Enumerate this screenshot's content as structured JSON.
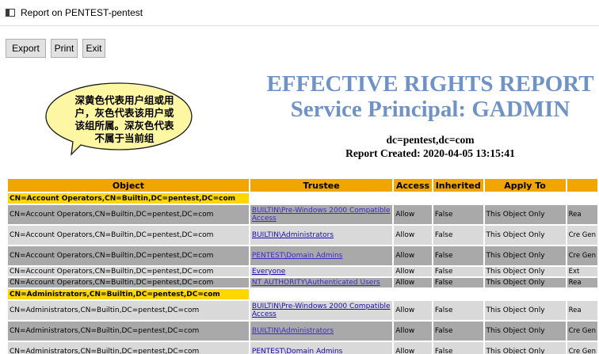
{
  "window": {
    "title": "Report on PENTEST-pentest"
  },
  "toolbar": {
    "export_label": "Export",
    "print_label": "Print",
    "exit_label": "Exit"
  },
  "callout": {
    "lines": [
      "深黄色代表用户组或用",
      "户，灰色代表该用户或",
      "该组所属。深灰色代表",
      "不属于当前组"
    ],
    "fill": "#fdf6a3",
    "stroke": "#1a1a1a"
  },
  "report": {
    "title": "EFFECTIVE RIGHTS REPORT",
    "subtitle": "Service Principal: GADMIN",
    "dc": "dc=pentest,dc=com",
    "created": "Report Created: 2020-04-05 13:15:41",
    "title_color": "#6f93c6"
  },
  "table": {
    "headers": [
      "Object",
      "Trustee",
      "Access",
      "Inherited",
      "Apply To",
      ""
    ],
    "header_color": "#f0a500",
    "group_color": "#ffd700",
    "rows": [
      {
        "kind": "group",
        "object": "CN=Account Operators,CN=Builtin,DC=pentest,DC=com"
      },
      {
        "kind": "dark tall",
        "object": "CN=Account Operators,CN=Builtin,DC=pentest,DC=com",
        "trustee": "BUILTIN\\Pre-Windows 2000 Compatible Access",
        "access": "Allow",
        "inherited": "False",
        "apply": "This Object Only",
        "perm": "Rea"
      },
      {
        "kind": "light tall",
        "object": "CN=Account Operators,CN=Builtin,DC=pentest,DC=com",
        "trustee": "BUILTIN\\Administrators",
        "access": "Allow",
        "inherited": "False",
        "apply": "This Object Only",
        "perm": "Cre Gen"
      },
      {
        "kind": "dark tall",
        "object": "CN=Account Operators,CN=Builtin,DC=pentest,DC=com",
        "trustee": "PENTEST\\Domain Admins",
        "access": "Allow",
        "inherited": "False",
        "apply": "This Object Only",
        "perm": "Cre Gen"
      },
      {
        "kind": "light short",
        "object": "CN=Account Operators,CN=Builtin,DC=pentest,DC=com",
        "trustee": "Everyone",
        "access": "Allow",
        "inherited": "False",
        "apply": "This Object Only",
        "perm": "Ext"
      },
      {
        "kind": "dark short",
        "object": "CN=Account Operators,CN=Builtin,DC=pentest,DC=com",
        "trustee": "NT AUTHORITY\\Authenticated Users",
        "access": "Allow",
        "inherited": "False",
        "apply": "This Object Only",
        "perm": "Rea"
      },
      {
        "kind": "group",
        "object": "CN=Administrators,CN=Builtin,DC=pentest,DC=com"
      },
      {
        "kind": "light tall",
        "object": "CN=Administrators,CN=Builtin,DC=pentest,DC=com",
        "trustee": "BUILTIN\\Pre-Windows 2000 Compatible Access",
        "access": "Allow",
        "inherited": "False",
        "apply": "This Object Only",
        "perm": "Rea"
      },
      {
        "kind": "dark tall",
        "object": "CN=Administrators,CN=Builtin,DC=pentest,DC=com",
        "trustee": "BUILTIN\\Administrators",
        "access": "Allow",
        "inherited": "False",
        "apply": "This Object Only",
        "perm": "Cre Gen"
      },
      {
        "kind": "light tall",
        "object": "CN=Administrators,CN=Builtin,DC=pentest,DC=com",
        "trustee": "PENTEST\\Domain Admins",
        "access": "Allow",
        "inherited": "False",
        "apply": "This Object Only",
        "perm": "Cre Gen"
      }
    ]
  }
}
